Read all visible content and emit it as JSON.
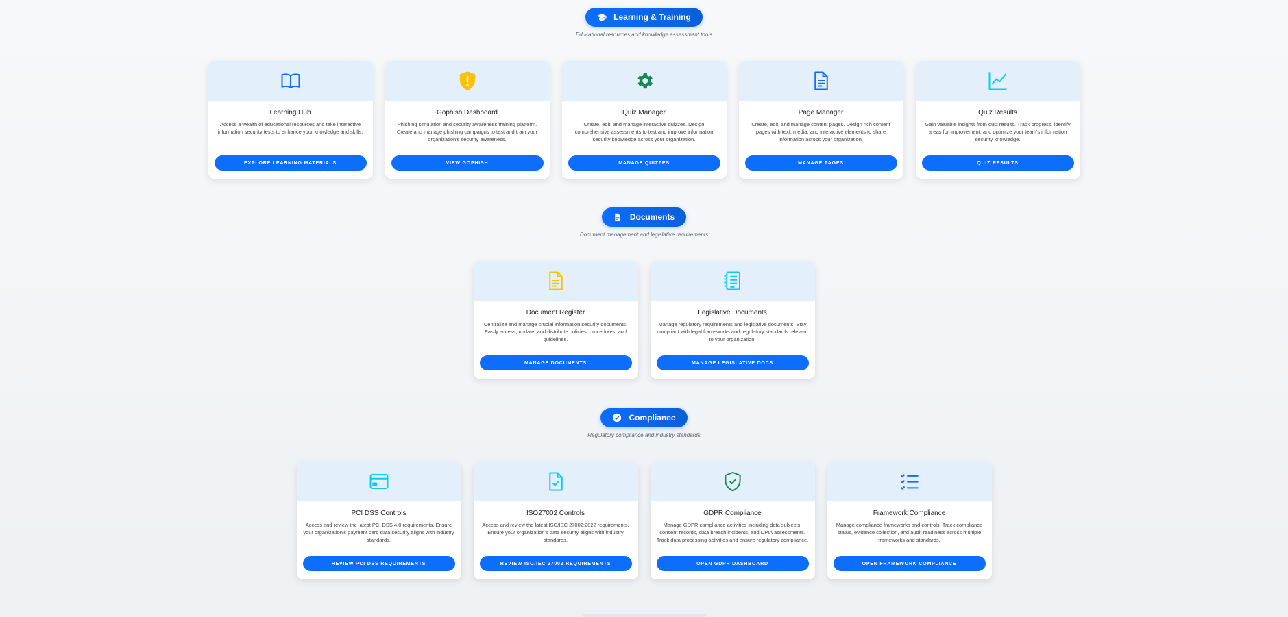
{
  "sections": [
    {
      "title": "Learning & Training",
      "subtitle": "Educational resources and knowledge assessment tools",
      "icon": "graduation-cap-icon",
      "cards": [
        {
          "title": "Learning Hub",
          "description": "Access a wealth of educational resources and take interactive information security tests to enhance your knowledge and skills.",
          "button": "EXPLORE LEARNING MATERIALS",
          "icon": "book-icon",
          "color": "#0d6efd"
        },
        {
          "title": "Gophish Dashboard",
          "description": "Phishing simulation and security awareness training platform. Create and manage phishing campaigns to test and train your organization's security awareness.",
          "button": "VIEW GOPHISH",
          "icon": "warning-shield-icon",
          "color": "#ffc107"
        },
        {
          "title": "Quiz Manager",
          "description": "Create, edit, and manage interactive quizzes. Design comprehensive assessments to test and improve information security knowledge across your organization.",
          "button": "MANAGE QUIZZES",
          "icon": "gear-icon",
          "color": "#198754"
        },
        {
          "title": "Page Manager",
          "description": "Create, edit, and manage content pages. Design rich content pages with text, media, and interactive elements to share information across your organization.",
          "button": "MANAGE PAGES",
          "icon": "document-icon",
          "color": "#0d6efd"
        },
        {
          "title": "Quiz Results",
          "description": "Gain valuable insights from quiz results. Track progress, identify areas for improvement, and optimize your team's information security knowledge.",
          "button": "QUIZ RESULTS",
          "icon": "line-chart-icon",
          "color": "#0dcaf0"
        }
      ]
    },
    {
      "title": "Documents",
      "subtitle": "Document management and legislative requirements",
      "icon": "file-icon",
      "cards": [
        {
          "title": "Document Register",
          "description": "Centralize and manage crucial information security documents. Easily access, update, and distribute policies, procedures, and guidelines.",
          "button": "MANAGE DOCUMENTS",
          "icon": "document-icon",
          "color": "#ffc107"
        },
        {
          "title": "Legislative Documents",
          "description": "Manage regulatory requirements and legislative documents. Stay compliant with legal frameworks and regulatory standards relevant to your organization.",
          "button": "MANAGE LEGISLATIVE DOCS",
          "icon": "list-document-icon",
          "color": "#0dcaf0"
        }
      ]
    },
    {
      "title": "Compliance",
      "subtitle": "Regulatory compliance and industry standards",
      "icon": "check-circle-icon",
      "cards": [
        {
          "title": "PCI DSS Controls",
          "description": "Access and review the latest PCI DSS 4.0 requirements. Ensure your organization's payment card data security aligns with industry standards.",
          "button": "REVIEW PCI DSS REQUIREMENTS",
          "icon": "credit-card-icon",
          "color": "#0dcaf0"
        },
        {
          "title": "ISO27002 Controls",
          "description": "Access and review the latest ISO/IEC 27002:2022 requirements. Ensure your organization's data security aligns with industry standards.",
          "button": "REVIEW ISO/IEC 27002 REQUIREMENTS",
          "icon": "file-check-icon",
          "color": "#0dcaf0"
        },
        {
          "title": "GDPR Compliance",
          "description": "Manage GDPR compliance activities including data subjects, consent records, data breach incidents, and DPIA assessments. Track data processing activities and ensure regulatory compliance.",
          "button": "OPEN GDPR DASHBOARD",
          "icon": "shield-check-icon",
          "color": "#198754"
        },
        {
          "title": "Framework Compliance",
          "description": "Manage compliance frameworks and controls. Track compliance status, evidence collection, and audit readiness across multiple frameworks and standards.",
          "button": "OPEN FRAMEWORK COMPLIANCE",
          "icon": "checklist-icon",
          "color": "#0d6efd"
        }
      ]
    }
  ]
}
